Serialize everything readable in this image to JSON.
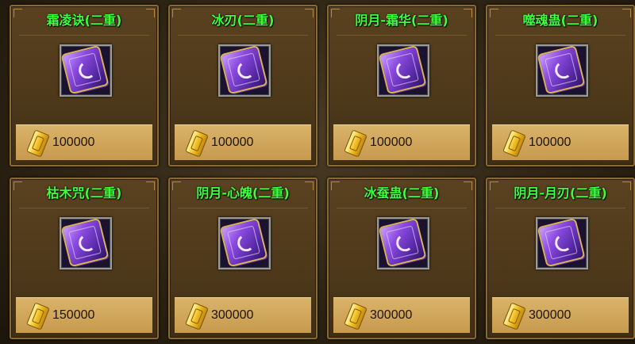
{
  "items": [
    {
      "name": "霜凌诀(二重)",
      "price": "100000",
      "icon": "purple-skill-book-icon"
    },
    {
      "name": "冰刃(二重)",
      "price": "100000",
      "icon": "purple-skill-book-icon"
    },
    {
      "name": "阴月-霜华(二重)",
      "price": "100000",
      "icon": "purple-skill-book-icon"
    },
    {
      "name": "噬魂蛊(二重)",
      "price": "100000",
      "icon": "purple-skill-book-icon"
    },
    {
      "name": "枯木咒(二重)",
      "price": "150000",
      "icon": "purple-skill-book-icon"
    },
    {
      "name": "阴月-心魄(二重)",
      "price": "300000",
      "icon": "purple-skill-book-icon"
    },
    {
      "name": "冰蚕蛊(二重)",
      "price": "300000",
      "icon": "purple-skill-book-icon"
    },
    {
      "name": "阴月-月刃(二重)",
      "price": "300000",
      "icon": "purple-skill-book-icon"
    }
  ],
  "currency_icon": "gold-ticket-icon",
  "colors": {
    "title": "#3dff3d",
    "card_border": "#8a6a34",
    "price_bar": "#d9b36a"
  }
}
